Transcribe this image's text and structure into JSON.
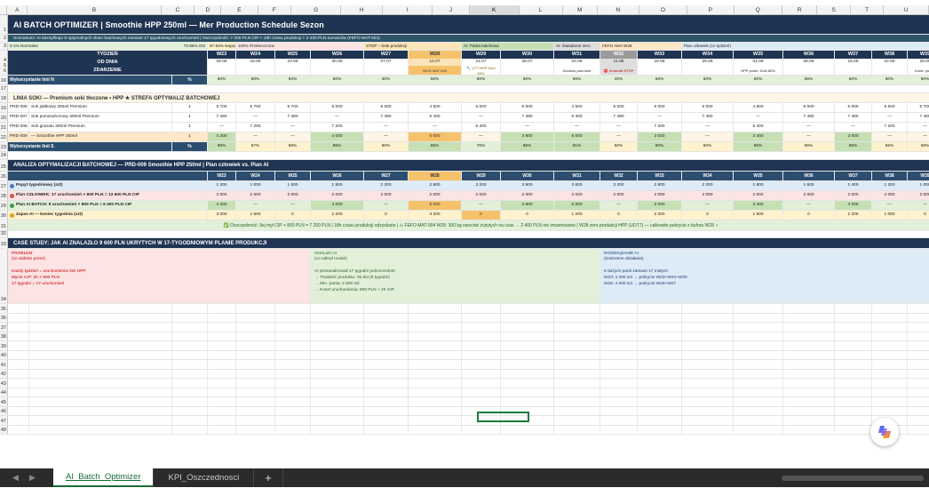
{
  "columns": [
    "A",
    "B",
    "C",
    "D",
    "E",
    "F",
    "G",
    "H",
    "I",
    "J",
    "K",
    "L",
    "M",
    "N",
    "O",
    "P",
    "Q",
    "R",
    "S",
    "T",
    "U"
  ],
  "selected_column": "K",
  "title_row": {
    "num": "1",
    "text": "AI BATCH OPTIMIZER | Smoothie HPP 250ml — Mer Production Schedule Sezon"
  },
  "scenario_row": {
    "num": "2",
    "text": "Scenariusz: AI identyfikuje 8 optymalnych okien batchowych zamiast 17 tygodniowych uruchomień | Oszczędność: 7 200 PLN CIP + 18h czasu produkcji + 2 400 PLN surowców (FEFO MAT-004)"
  },
  "legend_row": {
    "num": "3",
    "items": [
      {
        "label": "0-1% Normalne",
        "extra": "73-85% Ost"
      },
      {
        "label": "87-93% Napięte"
      },
      {
        "label": "100% Przekroczone"
      },
      {
        "label": "STOP – brak produkcji"
      },
      {
        "label": "AI: Partia batchowa"
      },
      {
        "label": "AI: Świadome zero"
      },
      {
        "label": "FEFO Alert W28"
      },
      {
        "label": "Plan człowiek (co tydzień)"
      }
    ]
  },
  "header": {
    "tydzien": "TYDZIEŃ",
    "od_dnia": "OD DNIA",
    "zdarzenie": "ZDARZENIE",
    "weeks": [
      "W23",
      "W24",
      "W25",
      "W26",
      "W27",
      "W28",
      "W29",
      "W30",
      "W31",
      "W32",
      "W33",
      "W34",
      "W35",
      "W36",
      "W37",
      "W38",
      "W39"
    ],
    "dates": [
      "09.06",
      "16.06",
      "23.06",
      "30.06",
      "07.07",
      "14.07",
      "21.07",
      "28.07",
      "04.08",
      "11.08",
      "18.08",
      "25.08",
      "01.09",
      "08.09",
      "15.09",
      "22.09",
      "29.09"
    ],
    "events": [
      "",
      "",
      "",
      "",
      "",
      "WHO MAT-004",
      "🔧 UTT HPP Sobi 60%",
      "",
      "Konkurs plan kold",
      "⛔ Kontrolki STOP",
      "",
      "",
      "HPP przeb. Sobi 80%",
      "",
      "",
      "",
      "Kontr. popsu"
    ]
  },
  "row16": {
    "num": "16",
    "label": "Wykorzystanie linii N",
    "unit": "%",
    "values": [
      "50%",
      "50%",
      "50%",
      "50%",
      "40%",
      "56%",
      "50%",
      "56%",
      "56%",
      "40%",
      "56%",
      "50%",
      "50%",
      "56%",
      "50%",
      "50%",
      "50%"
    ]
  },
  "row17": {
    "num": "17",
    "text": ""
  },
  "row18": {
    "num": "18",
    "text": "LINIA SOKI — Premium soki tłoczone • HPP ★ STREFA OPTYMALIZ BATCHOWEJ"
  },
  "products": [
    {
      "num": "19",
      "code": "PRD-006",
      "name": "Sok jabłkowy 300ml Premium",
      "unit": "1",
      "values": [
        "5 700",
        "5 700",
        "5 700",
        "6 000",
        "6 000",
        "4 500",
        "5 000",
        "6 000",
        "4 500",
        "6 000",
        "6 000",
        "5 000",
        "4 800",
        "5 000",
        "6 000",
        "5 500",
        "5 700"
      ]
    },
    {
      "num": "20",
      "code": "PRD-007",
      "name": "Sok pomarańczowy 300ml Premium",
      "unit": "1",
      "values": [
        "7 480",
        "—",
        "7 480",
        "—",
        "7 480",
        "5 400",
        "—",
        "7 480",
        "5 400",
        "7 480",
        "—",
        "7 480",
        "—",
        "7 480",
        "7 480",
        "—",
        "7 480"
      ]
    },
    {
      "num": "21",
      "code": "PRD-008",
      "name": "Sok granatu 300ml Premium",
      "unit": "1",
      "values": [
        "—",
        "7 200",
        "—",
        "7 200",
        "—",
        "—",
        "5 400",
        "—",
        "—",
        "—",
        "7 200",
        "—",
        "5 400",
        "—",
        "—",
        "7 200",
        "—"
      ]
    },
    {
      "num": "22",
      "code": "PRD-009",
      "name": "— Smoothie HPP 250ml",
      "unit": "1",
      "values": [
        "4 200",
        "—",
        "—",
        "4 000",
        "—",
        "6 000",
        "—",
        "3 800",
        "5 000",
        "—",
        "3 000",
        "—",
        "3 400",
        "—",
        "3 000",
        "—",
        "—"
      ]
    }
  ],
  "row23": {
    "num": "23",
    "label": "Wykorzystanie linii S",
    "unit": "%",
    "values": [
      "88%",
      "57%",
      "58%",
      "86%",
      "60%",
      "85%",
      "76%",
      "86%",
      "91%",
      "60%",
      "90%",
      "60%",
      "86%",
      "66%",
      "85%",
      "56%",
      "58%"
    ]
  },
  "row24": {
    "num": "24",
    "text": ""
  },
  "analysis_title": {
    "num": "25",
    "text": "ANALIZA OPTYMALIZACJI BATCHOWEJ — PRD-009 Smoothie HPP 250ml | Plan człowiek vs. Plan AI"
  },
  "analysis_header": {
    "num": "26",
    "weeks": [
      "W23",
      "W24",
      "W25",
      "W26",
      "W27",
      "W28",
      "W29",
      "W30",
      "W31",
      "W32",
      "W33",
      "W34",
      "W35",
      "W36",
      "W37",
      "W38",
      "W39"
    ]
  },
  "analysis_rows": [
    {
      "num": "27",
      "label": "Popyt tygodniowy (szt)",
      "values": [
        "1 200",
        "1 000",
        "1 600",
        "1 800",
        "2 200",
        "2 800",
        "3 200",
        "3 800",
        "3 600",
        "3 200",
        "2 800",
        "2 200",
        "1 800",
        "1 600",
        "1 400",
        "1 200",
        "1 000"
      ]
    },
    {
      "num": "28",
      "label": "Plan CZŁOWIEK: 17 uruchomień × 800 PLN = 13 600 PLN CIP",
      "values": [
        "2 000",
        "2 000",
        "2 000",
        "2 000",
        "2 000",
        "2 000",
        "2 000",
        "2 000",
        "2 000",
        "2 000",
        "2 000",
        "2 000",
        "2 000",
        "2 000",
        "2 000",
        "2 000",
        "2 000"
      ]
    },
    {
      "num": "29",
      "label": "Plan AI BATCH: 8 uruchomień × 800 PLN = 6 400 PLN CIP",
      "values": [
        "4 200",
        "—",
        "—",
        "4 000",
        "—",
        "6 000",
        "—",
        "3 800",
        "5 000",
        "—",
        "3 000",
        "—",
        "3 400",
        "—",
        "3 000",
        "—",
        "—"
      ]
    },
    {
      "num": "30",
      "label": "Zapas AI — koniec tygodnia (szt)",
      "values": [
        "3 000",
        "1 600",
        "0",
        "2 200",
        "0",
        "3 200",
        "0",
        "0",
        "1 200",
        "0",
        "2 200",
        "0",
        "1 600",
        "0",
        "2 200",
        "1 000",
        "0"
      ]
    }
  ],
  "summary_row": {
    "num": "31",
    "text": "✅ Oszczędność: 9ej mył CIP × 800 PLN = 7 200 PLN | 18h czasu produkcji odzyskane | ⚠ FEFO MAT-004 W28: 300 kg owoców zużytych na czas → 2 400 PLN nie zmarnowane | W28 zero produkcji HPP (UDT7) — całkowite pokrycie z bufora W28 ✓"
  },
  "row32": {
    "num": "32",
    "text": ""
  },
  "case_title": {
    "num": "33",
    "text": "CASE STUDY: JAK AI ZNALAZŁO 9 600 PLN UKRYTYCH W 17-TYGODNIOWYM PLANIE PRODUKCJI"
  },
  "case_problem": {
    "head": "PROBLEM",
    "sub": "(co widzisz przez)",
    "lines": [
      "Każdy tydzień = uruchomienie linii HPP.",
      "Mycie CIP: 2h × 800 PLN",
      "17 tygodni = 17 uruchomień"
    ]
  },
  "case_analysis": {
    "head": "ANALIZA AI",
    "sub": "(co odkrył model)",
    "lines": [
      "AI przeanalizował 17 tygodni jednocześnie:",
      "→ Trwałość produktu: 35 dni (5 tygodni)",
      "→ Min. partia: 2 800 szt",
      "→ Koszt uruchomienia: 800 PLN + 2h CIP"
    ]
  },
  "case_solution": {
    "head": "ROZWIĄZANIE AI",
    "sub": "(konkretne działania)",
    "lines": [
      "8 dużych partii zamiast 17 małych",
      "W23: 4 200 szt → pokrycie W23+W24+W25",
      "W26: 4 000 szt → pokrycie W26+W27"
    ]
  },
  "empty_rows": [
    "35",
    "36",
    "37",
    "38",
    "39",
    "40",
    "41",
    "42",
    "43",
    "44",
    "45",
    "46",
    "47",
    "48"
  ],
  "tabs": [
    {
      "label": "AI_Batch_Optimizer",
      "active": true
    },
    {
      "label": "KPI_Oszczednosci",
      "active": false
    }
  ],
  "add_tab": "+",
  "colors": {
    "navy": "#1f3452",
    "highlight": "#f5c26b",
    "green": "#c6e0b4",
    "select": "#1b7a3e"
  }
}
